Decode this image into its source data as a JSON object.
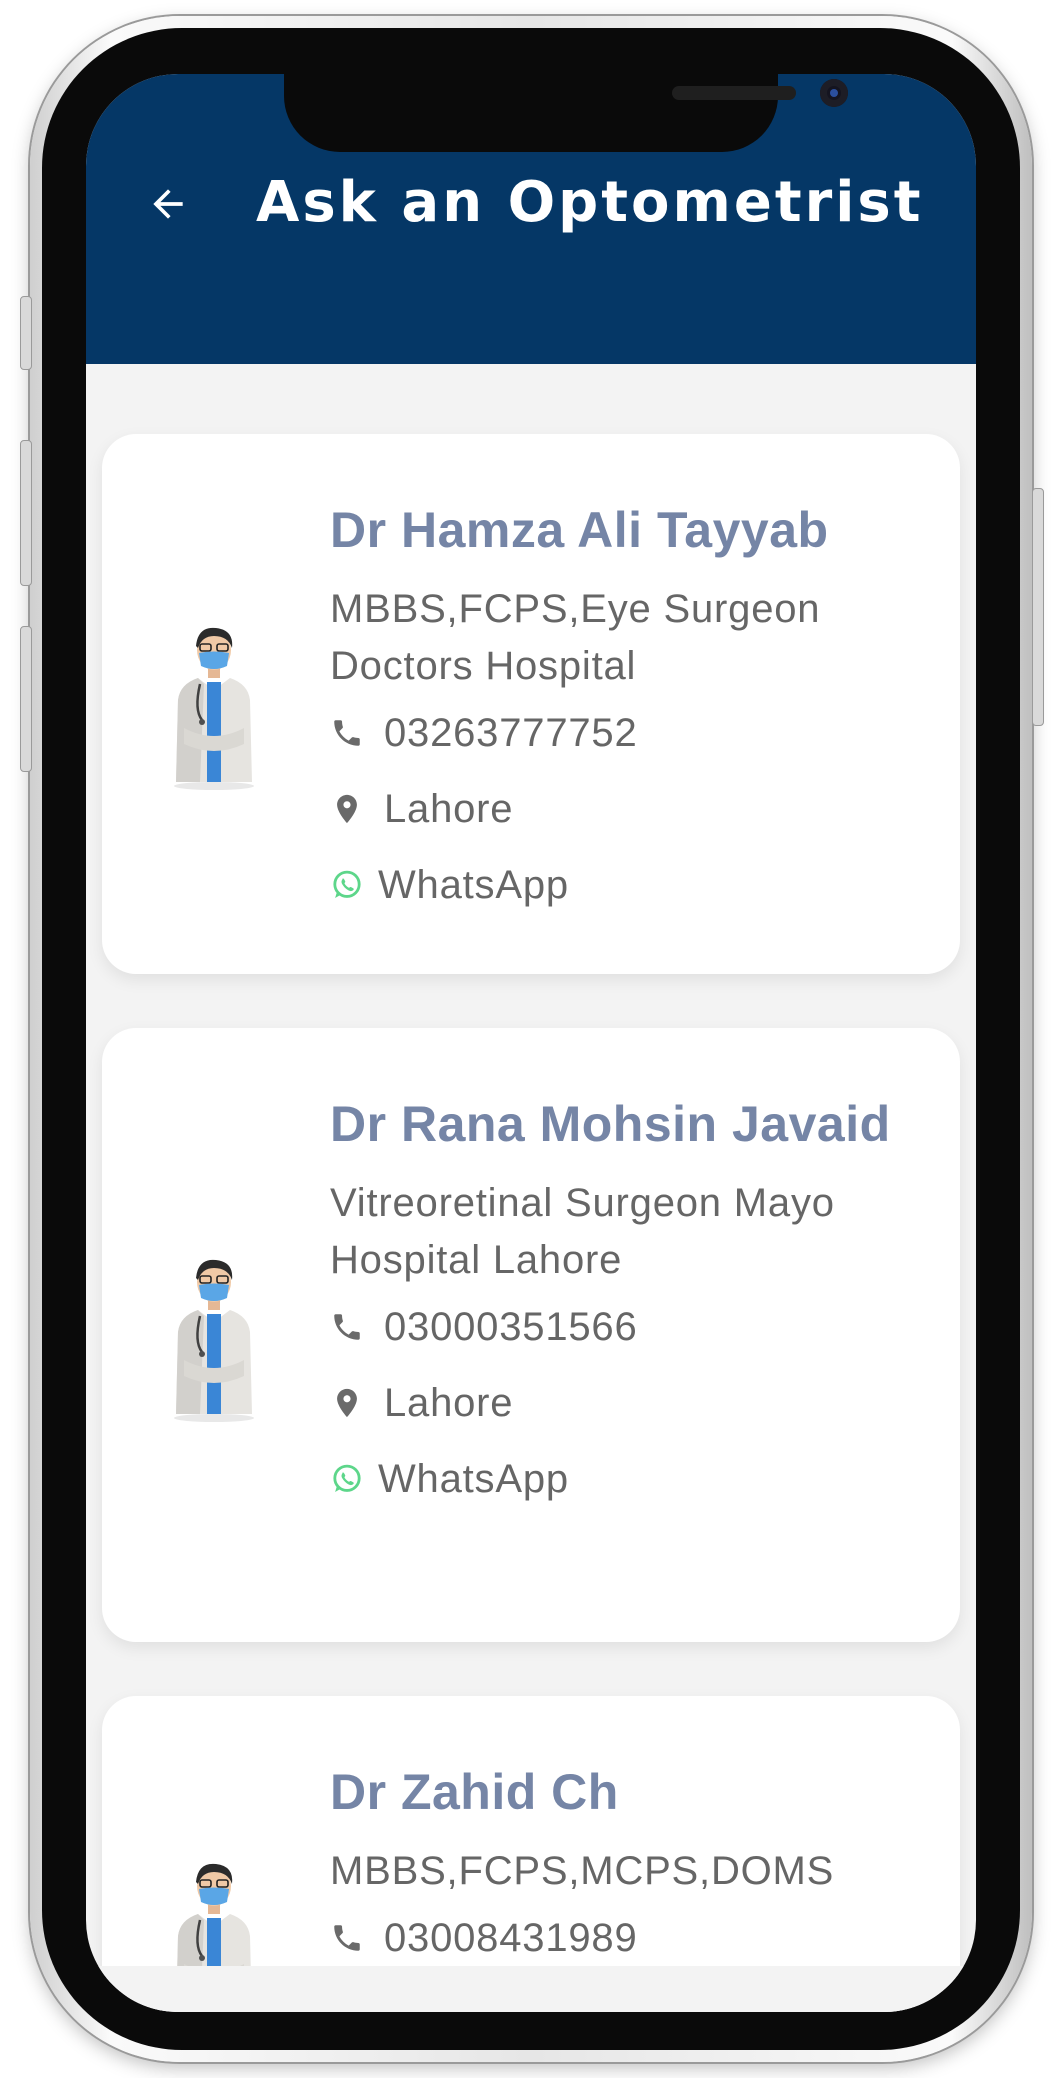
{
  "header": {
    "title": "Ask an Optometrist",
    "back_icon": "arrow-left-icon",
    "background": "#053766"
  },
  "doctors": [
    {
      "name": "Dr Hamza Ali Tayyab",
      "qualification": "MBBS,FCPS,Eye Surgeon Doctors Hospital",
      "phone": "03263777752",
      "city": "Lahore",
      "whatsapp_label": "WhatsApp"
    },
    {
      "name": "Dr Rana Mohsin Javaid",
      "qualification": "Vitreoretinal Surgeon Mayo Hospital Lahore",
      "phone": "03000351566",
      "city": "Lahore",
      "whatsapp_label": "WhatsApp"
    },
    {
      "name": "Dr Zahid Ch",
      "qualification": "MBBS,FCPS,MCPS,DOMS",
      "phone": "03008431989",
      "city": "",
      "whatsapp_label": ""
    }
  ],
  "icons": {
    "phone": "phone-icon",
    "location": "location-pin-icon",
    "whatsapp": "whatsapp-icon",
    "avatar": "doctor-avatar-icon"
  },
  "colors": {
    "name_text": "#7585a6",
    "detail_text": "#666666",
    "whatsapp_green": "#5dd68a"
  }
}
